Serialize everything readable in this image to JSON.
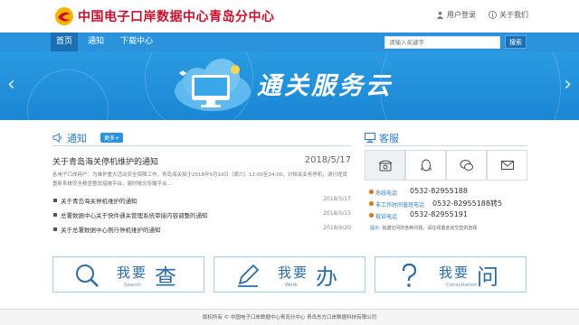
{
  "header": {
    "site_name": "中国电子口岸数据中心青岛分中心",
    "links": [
      {
        "label": "用户登录",
        "icon": "user-icon"
      },
      {
        "label": "关于我们",
        "icon": "info-icon"
      }
    ]
  },
  "nav": {
    "items": [
      "首页",
      "通知",
      "下载中心"
    ],
    "active": "首页",
    "search_placeholder": "请输入关键字",
    "search_button": "搜索"
  },
  "banner": {
    "title": "通关服务云",
    "prev_icon": "chevron-left-icon",
    "next_icon": "chevron-right-icon"
  },
  "notices": {
    "title": "通知",
    "more_label": "更多+",
    "headline": {
      "title": "关于青岛海关停机维护的通知",
      "date": "2018/5/17"
    },
    "summary": "各电子口岸用户：为维护重大活动安全保障工作，青岛海关拟于2018年5月19日（周六）12:00至24:00，对相关业务停机，请行提货重新系统安全精查整改措施平台。届时报文传输平台...",
    "list": [
      {
        "title": "关于青岛海关停机维护的通知",
        "date": "2018/5/17"
      },
      {
        "title": "总署数据中心关于快件通关管理系统审接内容调整的通知",
        "date": "2018/5/15"
      },
      {
        "title": "关于总署数据中心例行停机维护的通知",
        "date": "2018/4/20"
      }
    ]
  },
  "service": {
    "title": "客服",
    "icons": [
      "telephone-icon",
      "qq-icon",
      "wechat-icon",
      "mail-icon"
    ],
    "hotlines": [
      {
        "label": "热线电话",
        "number": "0532-82955188"
      },
      {
        "label": "非工作时间值班电话",
        "number": "0532-82955188转5"
      },
      {
        "label": "投诉电话",
        "number": "0532-82955191"
      }
    ],
    "tip_key": "提示:",
    "tip": "如遇空闲的各种问题，请在线邀咨询交直供选择"
  },
  "actions": [
    {
      "label": "我要",
      "big": "查",
      "sub": "Search",
      "icon": "search-icon"
    },
    {
      "label": "我要",
      "big": "办",
      "sub": "Work",
      "icon": "pencil-icon"
    },
    {
      "label": "我要",
      "big": "问",
      "sub": "Consultation",
      "icon": "question-icon"
    }
  ],
  "footer": {
    "text": "版权所有 © 中国电子口岸数据中心青岛分中心 青岛东方口岸数据科技有限公司"
  },
  "colors": {
    "brand_red": "#c8102e",
    "nav_blue": "#2b93dc",
    "nav_active": "#1d6fb3",
    "accent_blue": "#2b7cc2"
  }
}
